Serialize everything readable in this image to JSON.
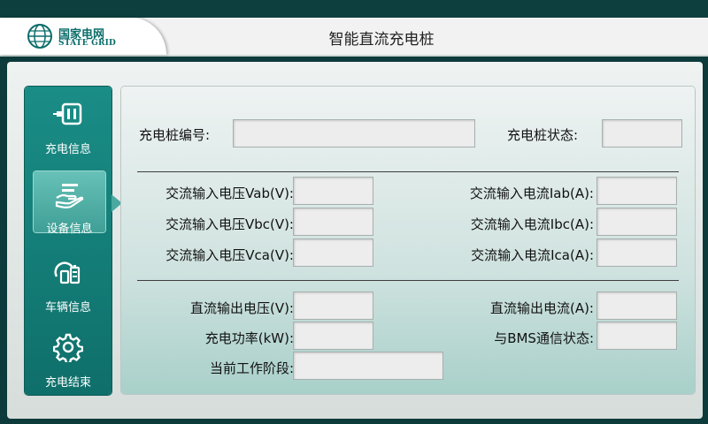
{
  "header": {
    "logo_cn": "国家电网",
    "logo_en": "STATE GRID",
    "title": "智能直流充电桩"
  },
  "nav": {
    "items": [
      {
        "label": "充电信息",
        "icon": "charger-plug-icon"
      },
      {
        "label": "设备信息",
        "icon": "device-hand-icon",
        "active": true
      },
      {
        "label": "车辆信息",
        "icon": "vehicle-battery-icon"
      },
      {
        "label": "充电结束",
        "icon": "gear-icon"
      }
    ]
  },
  "form": {
    "pile_no_label": "充电桩编号:",
    "pile_no_value": "",
    "pile_status_label": "充电桩状态:",
    "pile_status_value": "",
    "vab_label": "交流输入电压Vab(V):",
    "vab_value": "",
    "vbc_label": "交流输入电压Vbc(V):",
    "vbc_value": "",
    "vca_label": "交流输入电压Vca(V):",
    "vca_value": "",
    "iab_label": "交流输入电流Iab(A):",
    "iab_value": "",
    "ibc_label": "交流输入电流Ibc(A):",
    "ibc_value": "",
    "ica_label": "交流输入电流Ica(A):",
    "ica_value": "",
    "dc_voltage_label": "直流输出电压(V):",
    "dc_voltage_value": "",
    "dc_current_label": "直流输出电流(A):",
    "dc_current_value": "",
    "power_label": "充电功率(kW):",
    "power_value": "",
    "bms_label": "与BMS通信状态:",
    "bms_value": "",
    "stage_label": "当前工作阶段:",
    "stage_value": ""
  },
  "colors": {
    "brand": "#0a6d6a",
    "nav_bg": "#138079",
    "nav_active": "#56b3aa"
  }
}
